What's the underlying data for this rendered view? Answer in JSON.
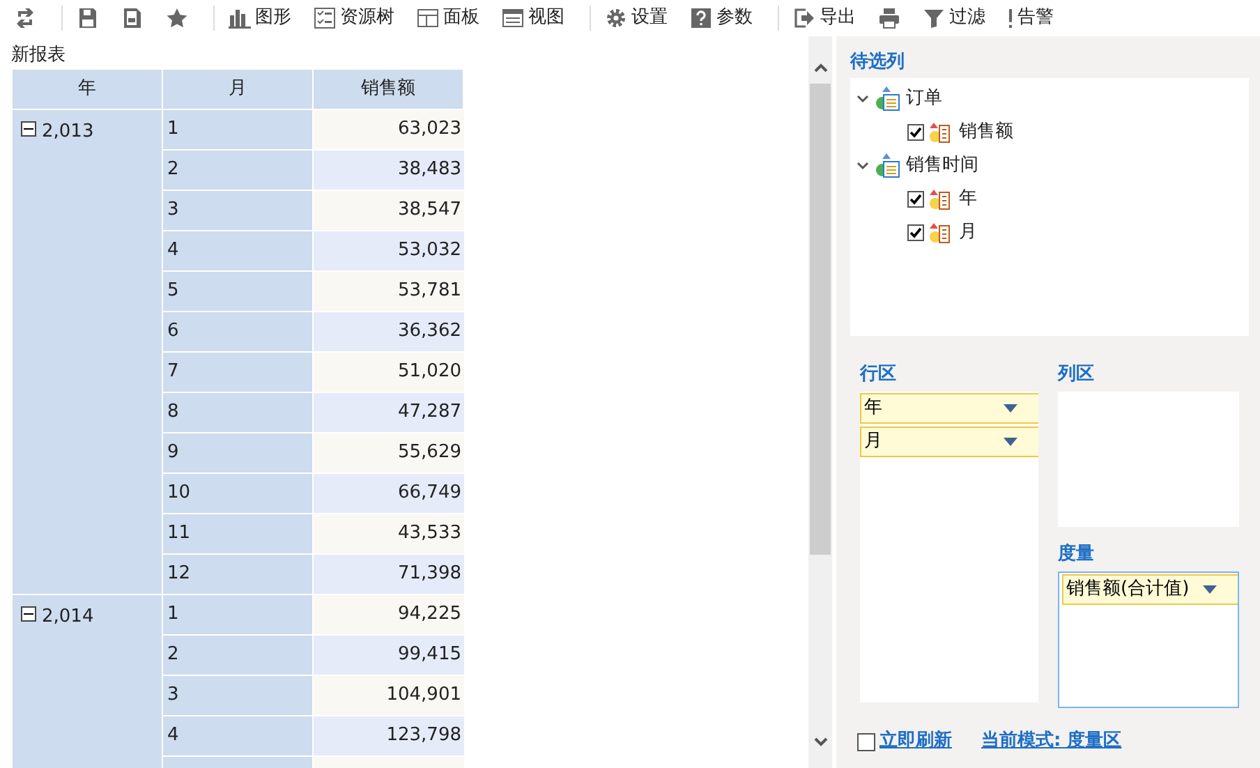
{
  "toolbar": [
    {
      "kind": "refresh"
    },
    {
      "kind": "save"
    },
    {
      "kind": "saveas"
    },
    {
      "kind": "star"
    },
    {
      "kind": "chart",
      "label": "图形"
    },
    {
      "kind": "tree",
      "label": "资源树"
    },
    {
      "kind": "panel",
      "label": "面板"
    },
    {
      "kind": "view",
      "label": "视图"
    },
    {
      "kind": "gear",
      "label": "设置"
    },
    {
      "kind": "help",
      "label": "参数"
    },
    {
      "kind": "export",
      "label": "导出"
    },
    {
      "kind": "print"
    },
    {
      "kind": "filter",
      "label": "过滤"
    },
    {
      "kind": "alert",
      "label": "告警"
    }
  ],
  "report_title": "新报表",
  "table": {
    "columns": [
      "年",
      "月",
      "销售额"
    ],
    "groups": [
      {
        "year": "2,013",
        "expanded": true,
        "rows": [
          [
            "1",
            "63,023"
          ],
          [
            "2",
            "38,483"
          ],
          [
            "3",
            "38,547"
          ],
          [
            "4",
            "53,032"
          ],
          [
            "5",
            "53,781"
          ],
          [
            "6",
            "36,362"
          ],
          [
            "7",
            "51,020"
          ],
          [
            "8",
            "47,287"
          ],
          [
            "9",
            "55,629"
          ],
          [
            "10",
            "66,749"
          ],
          [
            "11",
            "43,533"
          ],
          [
            "12",
            "71,398"
          ]
        ]
      },
      {
        "year": "2,014",
        "expanded": true,
        "rows": [
          [
            "1",
            "94,225"
          ],
          [
            "2",
            "99,415"
          ],
          [
            "3",
            "104,901"
          ],
          [
            "4",
            "123,798"
          ]
        ]
      }
    ]
  },
  "panel": {
    "candidates_title": "待选列",
    "tree": [
      {
        "label": "订单",
        "expanded": true,
        "children": [
          {
            "label": "销售额",
            "checked": true
          }
        ]
      },
      {
        "label": "销售时间",
        "expanded": true,
        "children": [
          {
            "label": "年",
            "checked": true
          },
          {
            "label": "月",
            "checked": true
          }
        ]
      }
    ],
    "row_area": {
      "title": "行区",
      "fields": [
        "年",
        "月"
      ]
    },
    "column_area": {
      "title": "列区"
    },
    "measure_area": {
      "title": "度量",
      "fields": [
        "销售额(合计值)"
      ],
      "selected": true
    },
    "auto_refresh": {
      "label": "立即刷新",
      "checked": false
    },
    "mode": "当前模式: 度量区"
  }
}
